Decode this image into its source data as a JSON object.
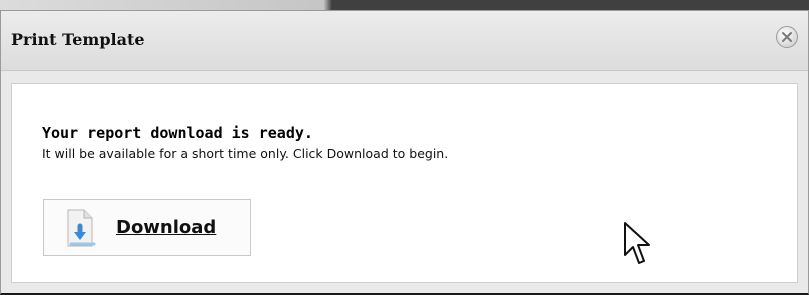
{
  "dialog": {
    "title": "Print Template",
    "close_icon": "close-icon"
  },
  "content": {
    "heading": "Your report download is ready.",
    "message": "It will be available for a short time only. Click Download to begin.",
    "download": {
      "label": "Download",
      "icon": "file-download-icon"
    }
  },
  "cursor": {
    "icon": "mouse-pointer-icon"
  }
}
